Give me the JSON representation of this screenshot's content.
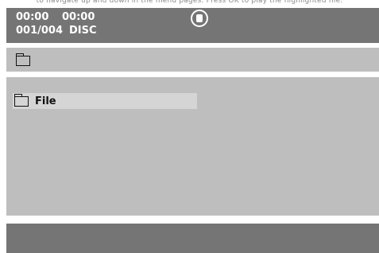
{
  "status": {
    "elapsed_time": "00:00",
    "total_time": "00:00",
    "track_counter": "001/004",
    "source": "DISC",
    "playback_state_icon": "stop-icon"
  },
  "path_bar": {
    "icon": "folder-icon"
  },
  "file_list": {
    "items": [
      {
        "icon": "folder-icon",
        "label": "File",
        "selected": true
      }
    ]
  },
  "colors": {
    "status_bar_bg": "#757575",
    "panel_bg": "#bebebe",
    "highlight_bg": "#d5d5d5",
    "bottom_bar_bg": "#757575"
  }
}
